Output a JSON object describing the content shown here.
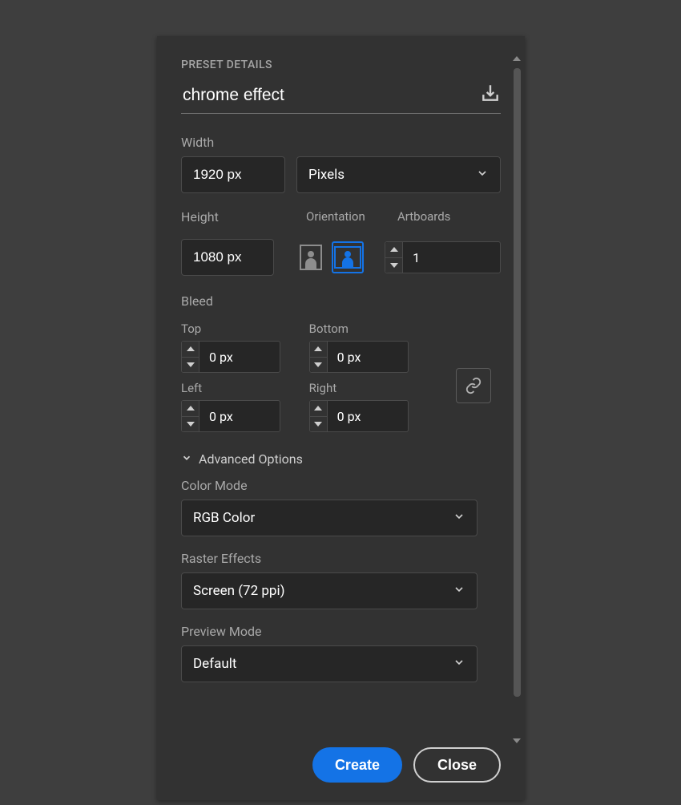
{
  "header": {
    "title": "PRESET DETAILS"
  },
  "preset": {
    "name": "chrome effect"
  },
  "width": {
    "label": "Width",
    "value": "1920 px"
  },
  "units": {
    "value": "Pixels"
  },
  "height": {
    "label": "Height",
    "value": "1080 px"
  },
  "orientation": {
    "label": "Orientation"
  },
  "artboards": {
    "label": "Artboards",
    "value": "1"
  },
  "bleed": {
    "label": "Bleed",
    "top": {
      "label": "Top",
      "value": "0 px"
    },
    "bottom": {
      "label": "Bottom",
      "value": "0 px"
    },
    "left": {
      "label": "Left",
      "value": "0 px"
    },
    "right": {
      "label": "Right",
      "value": "0 px"
    }
  },
  "advanced": {
    "header": "Advanced Options",
    "colorMode": {
      "label": "Color Mode",
      "value": "RGB Color"
    },
    "rasterEffects": {
      "label": "Raster Effects",
      "value": "Screen (72 ppi)"
    },
    "previewMode": {
      "label": "Preview Mode",
      "value": "Default"
    }
  },
  "buttons": {
    "create": "Create",
    "close": "Close"
  }
}
